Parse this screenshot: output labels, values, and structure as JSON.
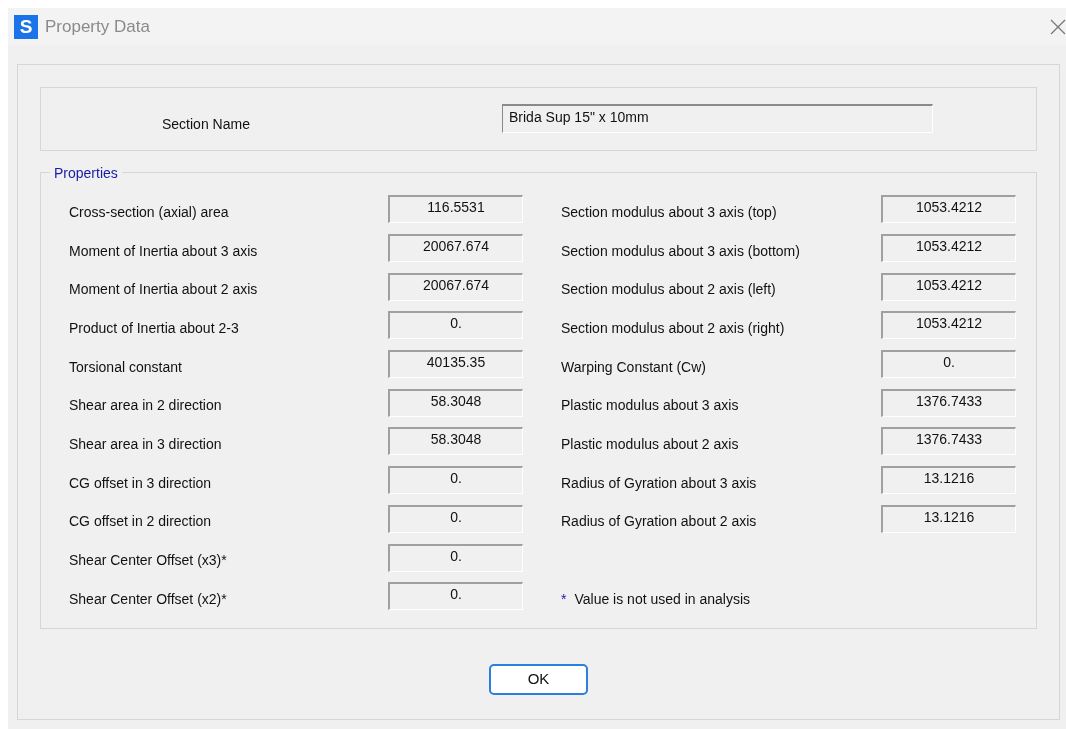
{
  "window": {
    "icon_letter": "S",
    "title": "Property Data"
  },
  "section_name": {
    "label": "Section Name",
    "value": "Brida Sup 15\" x 10mm"
  },
  "properties": {
    "title": "Properties",
    "left": [
      {
        "label": "Cross-section (axial) area",
        "value": "116.5531"
      },
      {
        "label": "Moment of Inertia about 3 axis",
        "value": "20067.674"
      },
      {
        "label": "Moment of Inertia about 2 axis",
        "value": "20067.674"
      },
      {
        "label": "Product of Inertia about 2-3",
        "value": "0."
      },
      {
        "label": "Torsional constant",
        "value": "40135.35"
      },
      {
        "label": "Shear area in 2 direction",
        "value": "58.3048"
      },
      {
        "label": "Shear area in 3 direction",
        "value": "58.3048"
      },
      {
        "label": "CG offset in 3 direction",
        "value": "0."
      },
      {
        "label": "CG offset in 2 direction",
        "value": "0."
      },
      {
        "label": "Shear Center Offset (x3)*",
        "value": "0."
      },
      {
        "label": "Shear Center Offset (x2)*",
        "value": "0."
      }
    ],
    "right": [
      {
        "label": "Section modulus about 3 axis (top)",
        "value": "1053.4212"
      },
      {
        "label": "Section modulus about 3 axis (bottom)",
        "value": "1053.4212"
      },
      {
        "label": "Section modulus about 2 axis (left)",
        "value": "1053.4212"
      },
      {
        "label": "Section modulus about 2 axis (right)",
        "value": "1053.4212"
      },
      {
        "label": "Warping Constant (Cw)",
        "value": "0."
      },
      {
        "label": "Plastic modulus about 3 axis",
        "value": "1376.7433"
      },
      {
        "label": "Plastic modulus about 2 axis",
        "value": "1376.7433"
      },
      {
        "label": "Radius of Gyration about 3 axis",
        "value": "13.1216"
      },
      {
        "label": "Radius of Gyration about 2 axis",
        "value": "13.1216"
      }
    ],
    "note_mark": "*",
    "note": "Value is not used in analysis"
  },
  "buttons": [
    "OK"
  ]
}
